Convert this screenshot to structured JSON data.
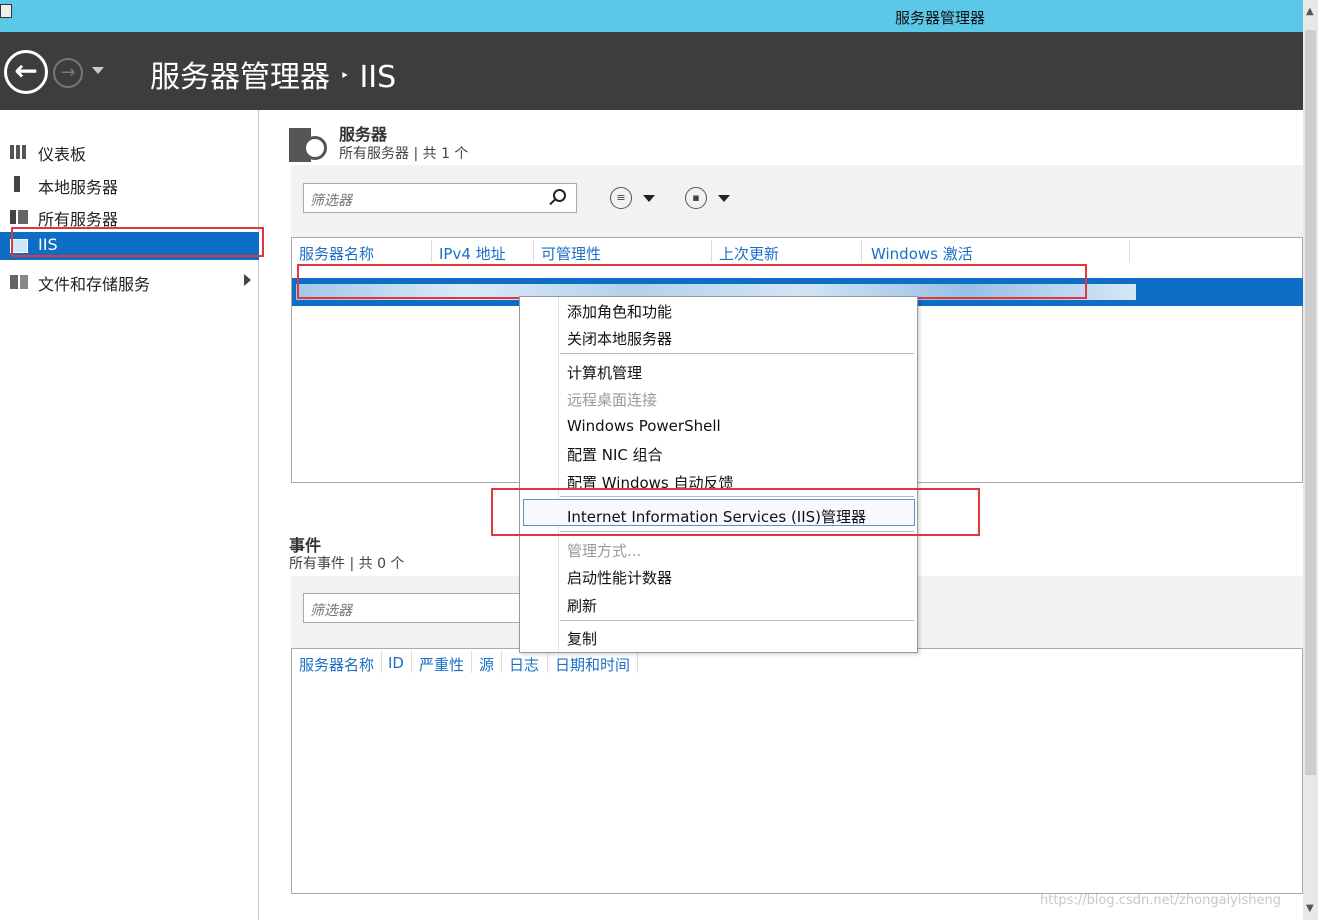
{
  "window": {
    "title": "服务器管理器"
  },
  "header": {
    "breadcrumb_root": "服务器管理器",
    "breadcrumb_sep": "‣",
    "breadcrumb_current": "IIS"
  },
  "sidebar": {
    "items": [
      {
        "label": "仪表板",
        "icon": "dashboard-icon"
      },
      {
        "label": "本地服务器",
        "icon": "local-server-icon"
      },
      {
        "label": "所有服务器",
        "icon": "all-servers-icon"
      },
      {
        "label": "IIS",
        "icon": "iis-icon",
        "selected": true
      },
      {
        "label": "文件和存储服务",
        "icon": "file-storage-icon",
        "has_submenu": true
      }
    ]
  },
  "servers": {
    "title": "服务器",
    "subtitle": "所有服务器 | 共 1 个",
    "filter_placeholder": "筛选器",
    "columns": [
      "服务器名称",
      "IPv4 地址",
      "可管理性",
      "上次更新",
      "Windows 激活"
    ]
  },
  "events": {
    "title": "事件",
    "subtitle": "所有事件 | 共 0 个",
    "filter_placeholder": "筛选器",
    "columns": [
      "服务器名称",
      "ID",
      "严重性",
      "源",
      "日志",
      "日期和时间"
    ]
  },
  "context_menu": {
    "items": [
      {
        "label": "添加角色和功能",
        "disabled": false
      },
      {
        "label": "关闭本地服务器",
        "disabled": false
      },
      {
        "label": "计算机管理",
        "disabled": false
      },
      {
        "label": "远程桌面连接",
        "disabled": true
      },
      {
        "label": "Windows PowerShell",
        "disabled": false
      },
      {
        "label": "配置 NIC 组合",
        "disabled": false
      },
      {
        "label": "配置 Windows 自动反馈",
        "disabled": false
      },
      {
        "label": "Internet Information Services (IIS)管理器",
        "disabled": false,
        "highlighted": true
      },
      {
        "label": "管理方式...",
        "disabled": true
      },
      {
        "label": "启动性能计数器",
        "disabled": false
      },
      {
        "label": "刷新",
        "disabled": false
      },
      {
        "label": "复制",
        "disabled": false
      }
    ]
  },
  "watermark": "https://blog.csdn.net/zhongaiyisheng",
  "colors": {
    "titlebar": "#5cc8e8",
    "header": "#3d3d3d",
    "selection": "#0e6ec6",
    "annotation": "#e0383a",
    "link": "#1a6fc6"
  }
}
